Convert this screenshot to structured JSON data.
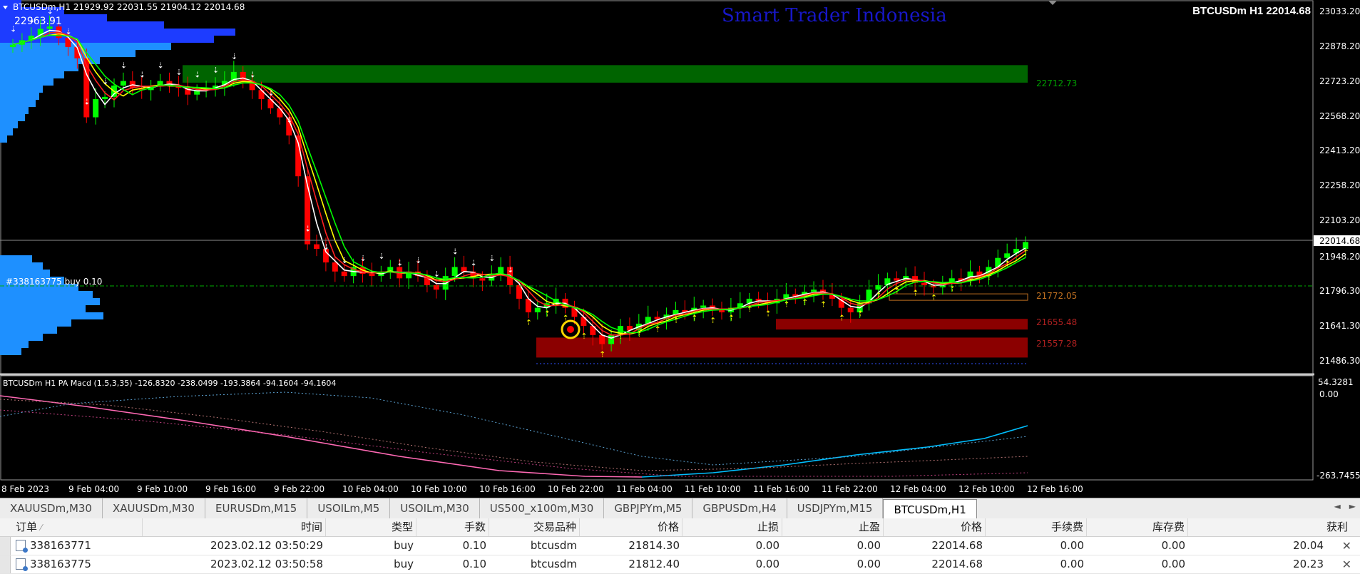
{
  "chart": {
    "symbol_line": "BTCUSDm,H1  21929.92 22031.55 21904.12 22014.68",
    "watermark": "Smart Trader Indonesia",
    "top_right_label": "BTCUSDm H1 22014.68",
    "high_label": "22963.91",
    "current_price": "22014.68",
    "order_label": "#338163775 buy 0.10",
    "zone_labels": [
      "22712.73",
      "21772.05",
      "21655.48",
      "21557.28"
    ],
    "price_scale": [
      "23033.20",
      "22878.20",
      "22723.20",
      "22568.20",
      "22413.20",
      "22258.20",
      "22103.20",
      "21948.20",
      "21796.30",
      "21641.30",
      "21486.30"
    ],
    "indicator_label": "BTCUSDm H1 PA Macd (1.5,3,35) -126.8320 -238.0499 -193.3864 -94.1604 -94.1604",
    "indicator_scale": [
      "54.3281",
      "0.00",
      "-263.7455"
    ],
    "time_labels": [
      "8 Feb 2023",
      "9 Feb 04:00",
      "9 Feb 10:00",
      "9 Feb 16:00",
      "9 Feb 22:00",
      "10 Feb 04:00",
      "10 Feb 10:00",
      "10 Feb 16:00",
      "10 Feb 22:00",
      "11 Feb 04:00",
      "11 Feb 10:00",
      "11 Feb 16:00",
      "11 Feb 22:00",
      "12 Feb 04:00",
      "12 Feb 10:00",
      "12 Feb 16:00"
    ],
    "colors": {
      "bull": "#00ff00",
      "bear": "#ff0000",
      "supply_zone": "#006400",
      "demand_zone": "#8b0000",
      "volume_profile": "#1e90ff",
      "macd_main": "#00bfff",
      "macd_signal": "#ff69b4"
    }
  },
  "tabs": [
    "XAUUSDm,M30",
    "XAUUSDm,M30",
    "EURUSDm,M15",
    "USOILm,M5",
    "USOILm,M30",
    "US500_x100m,M30",
    "GBPJPYm,M5",
    "GBPUSDm,H4",
    "USDJPYm,M15",
    "BTCUSDm,H1"
  ],
  "active_tab": "BTCUSDm,H1",
  "table": {
    "headers": [
      "订单",
      "时间",
      "类型",
      "手数",
      "交易品种",
      "价格",
      "止损",
      "止盈",
      "价格",
      "手续费",
      "库存费",
      "获利"
    ],
    "rows": [
      [
        "338163771",
        "2023.02.12 03:50:29",
        "buy",
        "0.10",
        "btcusdm",
        "21814.30",
        "0.00",
        "0.00",
        "22014.68",
        "0.00",
        "0.00",
        "20.04"
      ],
      [
        "338163775",
        "2023.02.12 03:50:58",
        "buy",
        "0.10",
        "btcusdm",
        "21812.40",
        "0.00",
        "0.00",
        "22014.68",
        "0.00",
        "0.00",
        "20.23"
      ]
    ]
  }
}
